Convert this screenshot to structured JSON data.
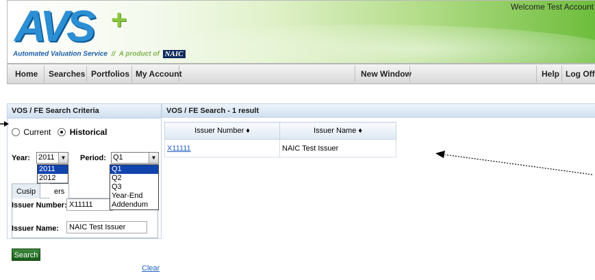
{
  "header": {
    "logo_text": "AVS",
    "logo_plus": "+",
    "tagline": "Automated Valuation Service",
    "tagline_sep": "//",
    "tagline_product": "A product of",
    "naic_badge": "NAIC",
    "welcome": "Welcome Test Account"
  },
  "nav": {
    "items": [
      "Home",
      "Searches",
      "Portfolios",
      "My Account"
    ],
    "new_window": "New Window",
    "help": "Help",
    "logoff": "Log Off"
  },
  "criteria": {
    "title": "VOS / FE Search Criteria",
    "radio_current": "Current",
    "radio_historical": "Historical",
    "selected_radio": "Historical",
    "year_label": "Year:",
    "year_value": "2011",
    "year_options": [
      "2011",
      "2012"
    ],
    "period_label": "Period:",
    "period_value": "Q1",
    "period_options": [
      "Q1",
      "Q2",
      "Q3",
      "Year-End",
      "Addendum"
    ],
    "tab_left": "Cusip",
    "tab_right": "ers",
    "issuer_number_label": "Issuer Number:",
    "issuer_number_value": "X11111",
    "issuer_name_label": "Issuer Name:",
    "issuer_name_value": "NAIC Test Issuer",
    "search_button": "Search",
    "clear_link": "Clear"
  },
  "results": {
    "title": "VOS / FE Search - 1 result",
    "columns": [
      "Issuer Number ♦",
      "Issuer Name ♦"
    ],
    "rows": [
      {
        "issuer_number": "X11111",
        "issuer_name": "NAIC Test Issuer"
      }
    ]
  },
  "colors": {
    "link": "#1f5fbf",
    "search_button": "#155c17",
    "dropdown_highlight": "#1244ad",
    "logo_blue": "#2c8fd4",
    "logo_green": "#8cc63f"
  }
}
